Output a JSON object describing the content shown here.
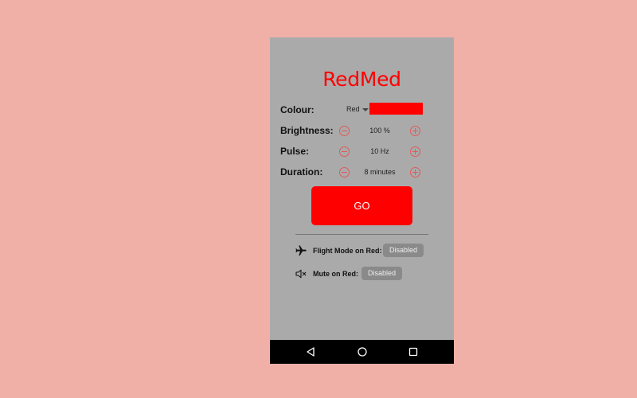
{
  "app": {
    "title": "RedMed"
  },
  "settings": {
    "colour": {
      "label": "Colour:",
      "selected": "Red",
      "swatch_color": "#ff0000"
    },
    "brightness": {
      "label": "Brightness:",
      "value": "100 %"
    },
    "pulse": {
      "label": "Pulse:",
      "value": "10 Hz"
    },
    "duration": {
      "label": "Duration:",
      "value": "8 minutes"
    }
  },
  "go_button": {
    "label": "GO"
  },
  "toggles": {
    "flight_mode": {
      "label": "Flight Mode on Red:",
      "state": "Disabled"
    },
    "mute": {
      "label": "Mute on Red:",
      "state": "Disabled"
    }
  },
  "navbar": {
    "back_icon": "back-triangle",
    "home_icon": "home-circle",
    "recents_icon": "recents-square"
  },
  "colors": {
    "accent": "#ff0000",
    "background": "#f0b0a8",
    "screen": "#aaaaaa"
  }
}
